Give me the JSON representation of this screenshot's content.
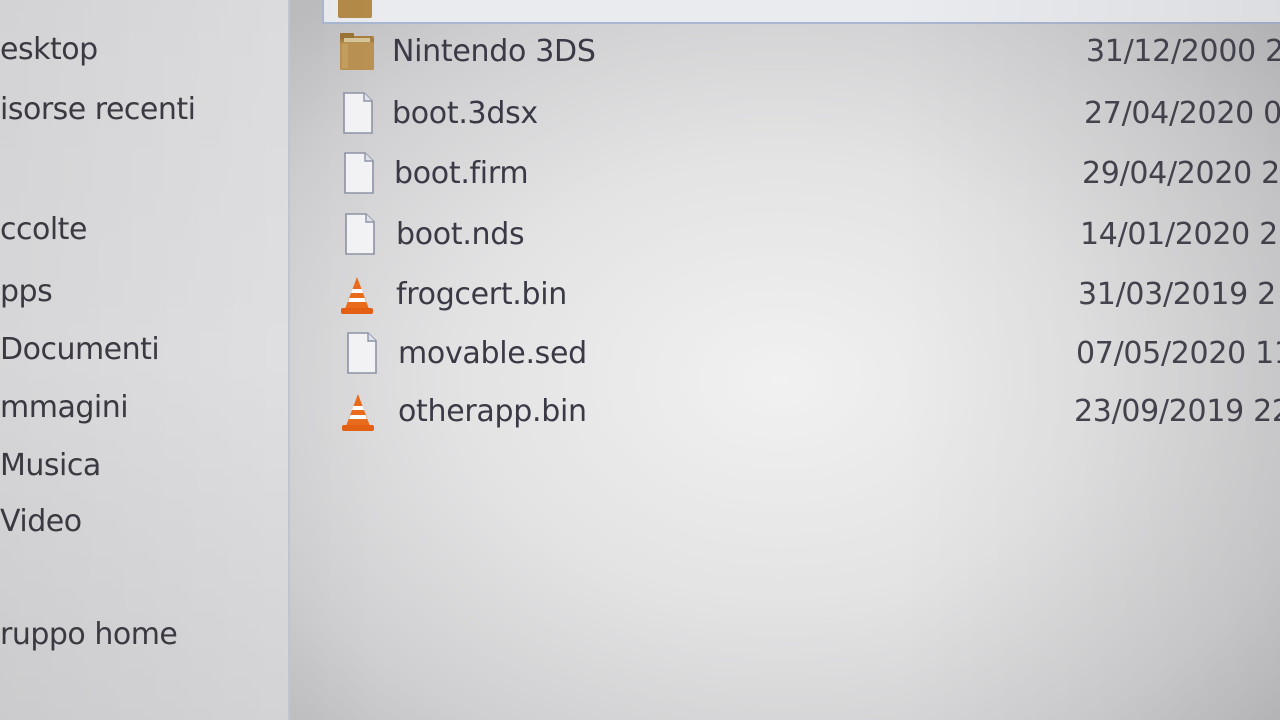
{
  "navigation": {
    "items": [
      {
        "label": "esktop",
        "icon": "desktop-icon"
      },
      {
        "label": "isorse recenti",
        "icon": "recent-places-icon"
      },
      {
        "label": "ccolte",
        "icon": "libraries-icon"
      },
      {
        "label": "pps",
        "icon": "apps-icon"
      },
      {
        "label": "Documenti",
        "icon": "documents-icon"
      },
      {
        "label": "mmagini",
        "icon": "pictures-icon"
      },
      {
        "label": "Musica",
        "icon": "music-icon"
      },
      {
        "label": "Video",
        "icon": "video-icon"
      },
      {
        "label": "ruppo home",
        "icon": "homegroup-icon"
      }
    ]
  },
  "files": [
    {
      "name": "Nintendo 3DS",
      "date": "31/12/2000 2",
      "icon": "folder-icon"
    },
    {
      "name": "boot.3dsx",
      "date": "27/04/2020 0",
      "icon": "file-icon"
    },
    {
      "name": "boot.firm",
      "date": "29/04/2020 2",
      "icon": "file-icon"
    },
    {
      "name": "boot.nds",
      "date": "14/01/2020 2",
      "icon": "file-icon"
    },
    {
      "name": "frogcert.bin",
      "date": "31/03/2019 2",
      "icon": "vlc-cone-icon"
    },
    {
      "name": "movable.sed",
      "date": "07/05/2020 11",
      "icon": "file-icon"
    },
    {
      "name": "otherapp.bin",
      "date": "23/09/2019 22",
      "icon": "vlc-cone-icon"
    }
  ],
  "colors": {
    "folder": "#b38a48",
    "vlc_orange": "#e8661a",
    "selection_border": "#a9b6cf",
    "text": "#3a3a46"
  }
}
